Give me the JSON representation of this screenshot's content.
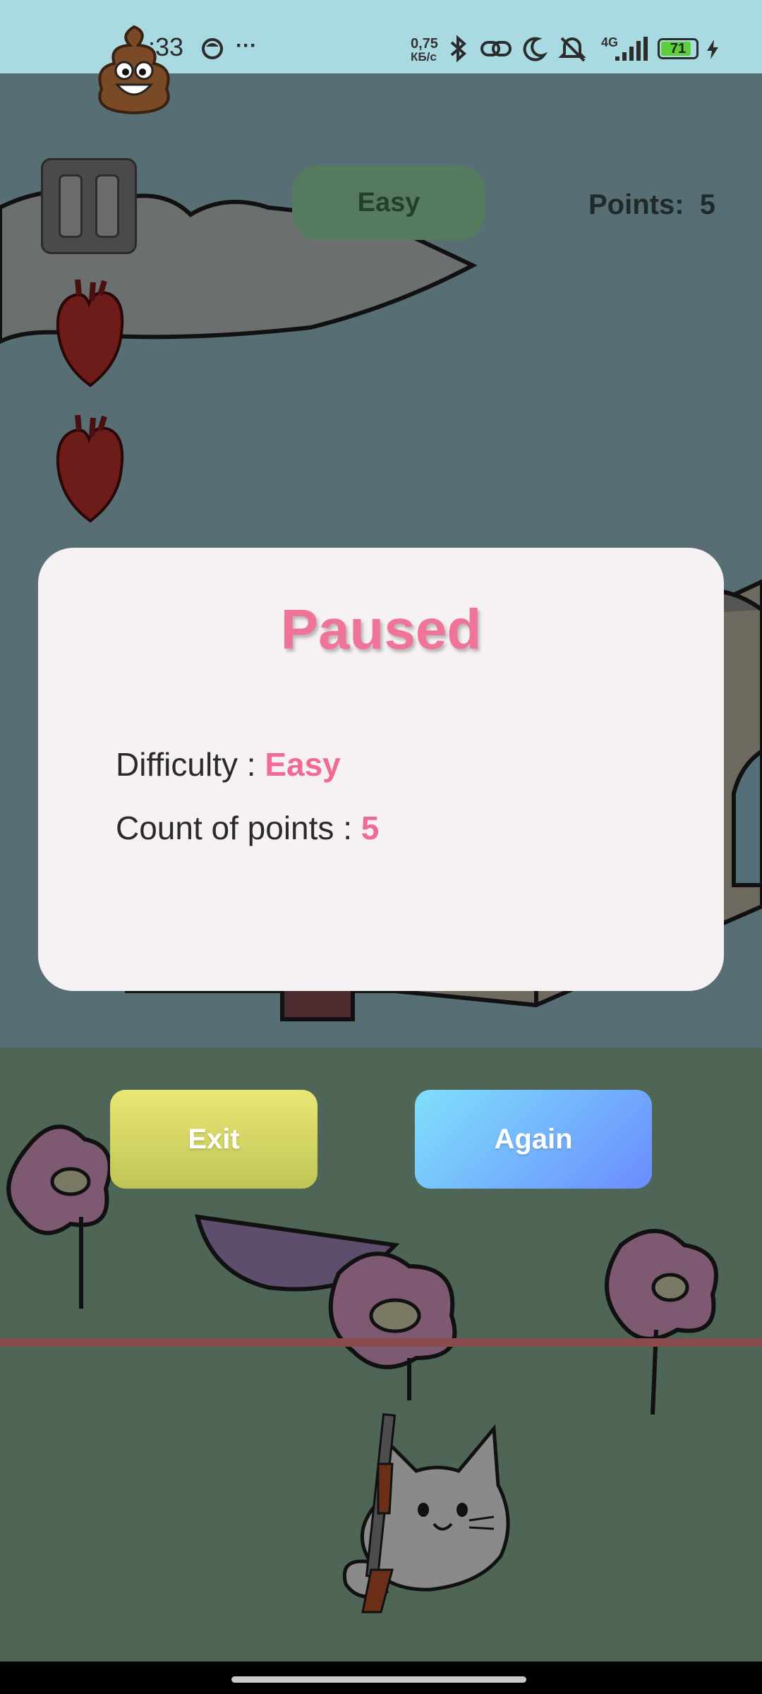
{
  "status_bar": {
    "time": ":33",
    "network_speed_value": "0,75",
    "network_speed_unit": "КБ/с",
    "more_indicator": "···",
    "signal_type": "4G",
    "battery_level": "71",
    "icons": [
      "bluetooth-icon",
      "link-icon",
      "moon-icon",
      "mute-icon",
      "signal-icon",
      "battery-icon",
      "charging-icon"
    ]
  },
  "hud": {
    "difficulty_chip": "Easy",
    "points_label": "Points:  5",
    "lives": 2
  },
  "dialog": {
    "title": "Paused",
    "difficulty_label": "Difficulty : ",
    "difficulty_value": "Easy",
    "points_label": "Count of points : ",
    "points_value": "5"
  },
  "buttons": {
    "exit": "Exit",
    "again": "Again"
  },
  "colors": {
    "accent_pink": "#f06a92",
    "exit_button": "#d8d966",
    "again_button": "#74b6fd",
    "status_bar": "#a9dae2",
    "difficulty_chip": "#557a5e"
  }
}
